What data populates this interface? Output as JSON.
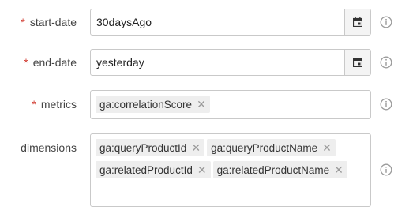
{
  "fields": {
    "start_date": {
      "label": "start-date",
      "required_mark": "*",
      "value": "30daysAgo"
    },
    "end_date": {
      "label": "end-date",
      "required_mark": "*",
      "value": "yesterday"
    },
    "metrics": {
      "label": "metrics",
      "required_mark": "*",
      "chips": [
        "ga:correlationScore"
      ]
    },
    "dimensions": {
      "label": "dimensions",
      "chips": [
        "ga:queryProductId",
        "ga:queryProductName",
        "ga:relatedProductId",
        "ga:relatedProductName"
      ]
    }
  },
  "icons": {
    "calendar": "calendar-icon",
    "remove": "close-icon",
    "info": "info-icon",
    "remove_glyph": "✕"
  },
  "colors": {
    "required": "#d0362c",
    "chip_bg": "#eeeeee",
    "border": "#c9c9c9"
  }
}
